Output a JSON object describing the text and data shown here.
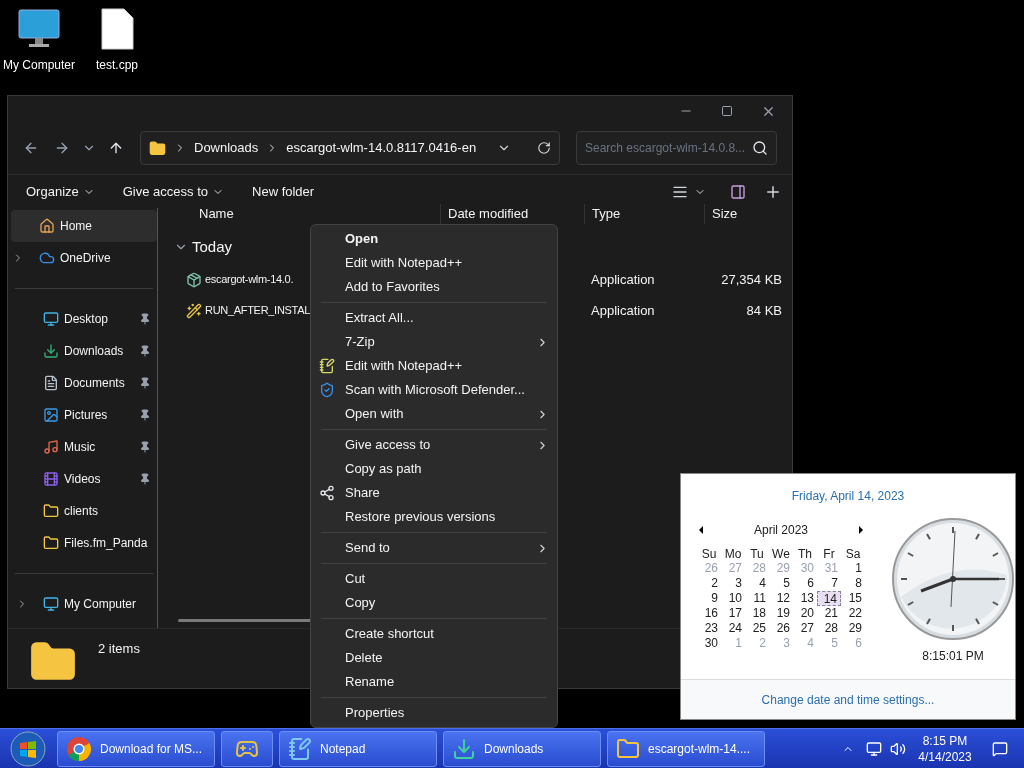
{
  "desktop_icons": [
    {
      "label": "My Computer",
      "kind": "computer"
    },
    {
      "label": "test.cpp",
      "kind": "file"
    }
  ],
  "explorer": {
    "address": [
      "Downloads",
      "escargot-wlm-14.0.8117.0416-en"
    ],
    "search": {
      "placeholder": "Search escargot-wlm-14.0.8..."
    },
    "commands": [
      {
        "label": "Organize",
        "dropdown": true
      },
      {
        "label": "Give access to",
        "dropdown": true
      },
      {
        "label": "New folder",
        "dropdown": false
      }
    ],
    "sidebar": [
      {
        "items": [
          {
            "label": "Home",
            "kind": "home",
            "pinned": false,
            "expandable": false,
            "selected": true
          },
          {
            "label": "OneDrive",
            "kind": "cloud",
            "pinned": false,
            "expandable": true,
            "selected": false
          }
        ]
      },
      {
        "items": [
          {
            "label": "Desktop",
            "kind": "desktop",
            "pinned": true,
            "expandable": false,
            "selected": false
          },
          {
            "label": "Downloads",
            "kind": "download",
            "pinned": true,
            "expandable": false,
            "selected": false
          },
          {
            "label": "Documents",
            "kind": "document",
            "pinned": true,
            "expandable": false,
            "selected": false
          },
          {
            "label": "Pictures",
            "kind": "picture",
            "pinned": true,
            "expandable": false,
            "selected": false
          },
          {
            "label": "Music",
            "kind": "music",
            "pinned": true,
            "expandable": false,
            "selected": false
          },
          {
            "label": "Videos",
            "kind": "video",
            "pinned": true,
            "expandable": false,
            "selected": false
          },
          {
            "label": "clients",
            "kind": "folder",
            "pinned": false,
            "expandable": false,
            "selected": false
          },
          {
            "label": "Files.fm_Panda",
            "kind": "folder",
            "pinned": false,
            "expandable": false,
            "selected": false
          }
        ]
      },
      {
        "items": [
          {
            "label": "My Computer",
            "kind": "computer",
            "pinned": false,
            "expandable": true,
            "selected": false
          }
        ]
      }
    ],
    "columns": [
      "Name",
      "Date modified",
      "Type",
      "Size"
    ],
    "group": "Today",
    "files": [
      {
        "name": "escargot-wlm-14.0.",
        "kind": "installer",
        "type": "Application",
        "size": "27,354 KB"
      },
      {
        "name": "RUN_AFTER_INSTAL",
        "kind": "wand",
        "type": "Application",
        "size": "84 KB"
      }
    ],
    "status": "2 items"
  },
  "context_menu": [
    {
      "kind": "plain",
      "label": "Open",
      "bold": true,
      "submenu": false
    },
    {
      "kind": "plain",
      "label": "Edit with Notepad++",
      "bold": false,
      "submenu": false
    },
    {
      "kind": "plain",
      "label": "Add to Favorites",
      "bold": false,
      "submenu": false
    },
    {
      "kind": "separator"
    },
    {
      "kind": "plain",
      "label": "Extract All...",
      "bold": false,
      "submenu": false
    },
    {
      "kind": "plain",
      "label": "7-Zip",
      "bold": false,
      "submenu": true
    },
    {
      "kind": "notepad",
      "label": "Edit with Notepad++",
      "bold": false,
      "submenu": false
    },
    {
      "kind": "shield",
      "label": "Scan with Microsoft Defender...",
      "bold": false,
      "submenu": false
    },
    {
      "kind": "plain",
      "label": "Open with",
      "bold": false,
      "submenu": true
    },
    {
      "kind": "separator"
    },
    {
      "kind": "plain",
      "label": "Give access to",
      "bold": false,
      "submenu": true
    },
    {
      "kind": "plain",
      "label": "Copy as path",
      "bold": false,
      "submenu": false
    },
    {
      "kind": "share",
      "label": "Share",
      "bold": false,
      "submenu": false
    },
    {
      "kind": "plain",
      "label": "Restore previous versions",
      "bold": false,
      "submenu": false
    },
    {
      "kind": "separator"
    },
    {
      "kind": "plain",
      "label": "Send to",
      "bold": false,
      "submenu": true
    },
    {
      "kind": "separator"
    },
    {
      "kind": "plain",
      "label": "Cut",
      "bold": false,
      "submenu": false
    },
    {
      "kind": "plain",
      "label": "Copy",
      "bold": false,
      "submenu": false
    },
    {
      "kind": "separator"
    },
    {
      "kind": "plain",
      "label": "Create shortcut",
      "bold": false,
      "submenu": false
    },
    {
      "kind": "plain",
      "label": "Delete",
      "bold": false,
      "submenu": false
    },
    {
      "kind": "plain",
      "label": "Rename",
      "bold": false,
      "submenu": false
    },
    {
      "kind": "separator"
    },
    {
      "kind": "plain",
      "label": "Properties",
      "bold": false,
      "submenu": false
    }
  ],
  "clock_popup": {
    "date": "Friday, April 14, 2023",
    "month": "April 2023",
    "weekdays": [
      "Su",
      "Mo",
      "Tu",
      "We",
      "Th",
      "Fr",
      "Sa"
    ],
    "days": [
      {
        "text": "26",
        "muted": true,
        "selected": false
      },
      {
        "text": "27",
        "muted": true,
        "selected": false
      },
      {
        "text": "28",
        "muted": true,
        "selected": false
      },
      {
        "text": "29",
        "muted": true,
        "selected": false
      },
      {
        "text": "30",
        "muted": true,
        "selected": false
      },
      {
        "text": "31",
        "muted": true,
        "selected": false
      },
      {
        "text": "1",
        "muted": false,
        "selected": false
      },
      {
        "text": "2",
        "muted": false,
        "selected": false
      },
      {
        "text": "3",
        "muted": false,
        "selected": false
      },
      {
        "text": "4",
        "muted": false,
        "selected": false
      },
      {
        "text": "5",
        "muted": false,
        "selected": false
      },
      {
        "text": "6",
        "muted": false,
        "selected": false
      },
      {
        "text": "7",
        "muted": false,
        "selected": false
      },
      {
        "text": "8",
        "muted": false,
        "selected": false
      },
      {
        "text": "9",
        "muted": false,
        "selected": false
      },
      {
        "text": "10",
        "muted": false,
        "selected": false
      },
      {
        "text": "11",
        "muted": false,
        "selected": false
      },
      {
        "text": "12",
        "muted": false,
        "selected": false
      },
      {
        "text": "13",
        "muted": false,
        "selected": false
      },
      {
        "text": "14",
        "muted": false,
        "selected": true
      },
      {
        "text": "15",
        "muted": false,
        "selected": false
      },
      {
        "text": "16",
        "muted": false,
        "selected": false
      },
      {
        "text": "17",
        "muted": false,
        "selected": false
      },
      {
        "text": "18",
        "muted": false,
        "selected": false
      },
      {
        "text": "19",
        "muted": false,
        "selected": false
      },
      {
        "text": "20",
        "muted": false,
        "selected": false
      },
      {
        "text": "21",
        "muted": false,
        "selected": false
      },
      {
        "text": "22",
        "muted": false,
        "selected": false
      },
      {
        "text": "23",
        "muted": false,
        "selected": false
      },
      {
        "text": "24",
        "muted": false,
        "selected": false
      },
      {
        "text": "25",
        "muted": false,
        "selected": false
      },
      {
        "text": "26",
        "muted": false,
        "selected": false
      },
      {
        "text": "27",
        "muted": false,
        "selected": false
      },
      {
        "text": "28",
        "muted": false,
        "selected": false
      },
      {
        "text": "29",
        "muted": false,
        "selected": false
      },
      {
        "text": "30",
        "muted": false,
        "selected": false
      },
      {
        "text": "1",
        "muted": true,
        "selected": false
      },
      {
        "text": "2",
        "muted": true,
        "selected": false
      },
      {
        "text": "3",
        "muted": true,
        "selected": false
      },
      {
        "text": "4",
        "muted": true,
        "selected": false
      },
      {
        "text": "5",
        "muted": true,
        "selected": false
      },
      {
        "text": "6",
        "muted": true,
        "selected": false
      }
    ],
    "time": "8:15:01 PM",
    "settings_link": "Change date and time settings..."
  },
  "taskbar": {
    "tasks": [
      {
        "label": "Download for MS...",
        "kind": "chrome"
      },
      {
        "kind": "game"
      },
      {
        "label": "Notepad",
        "kind": "notepad"
      },
      {
        "label": "Downloads",
        "kind": "download"
      },
      {
        "label": "escargot-wlm-14....",
        "kind": "folder"
      }
    ],
    "time": "8:15 PM",
    "date": "4/14/2023"
  }
}
